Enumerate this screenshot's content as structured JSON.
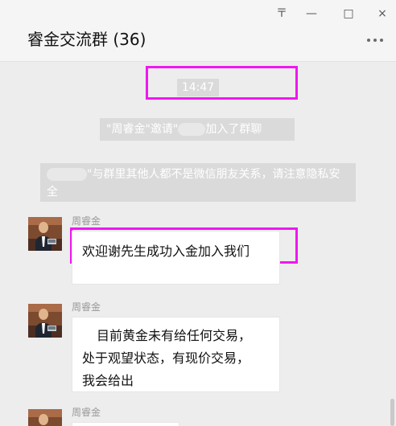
{
  "window": {
    "title": "睿金交流群 (36)",
    "pin_glyph": "〒",
    "minimize_glyph": "—",
    "maximize_glyph": "□",
    "close_glyph": "×"
  },
  "chat": {
    "timestamp": "14:47",
    "system_messages": {
      "invite_prefix": "\"周睿金\"邀请\"",
      "invite_suffix": "加入了群聊",
      "warning_suffix": "\"与群里其他人都不是微信朋友关系，请注意隐私安全"
    },
    "messages": [
      {
        "sender": "周睿金",
        "lines": [
          "欢迎谢先生成功入金加入我们"
        ]
      },
      {
        "sender": "周睿金",
        "lines": [
          "目前黄金未有给任何交易，",
          "处于观望状态，有现价交易，",
          "我会给出"
        ]
      },
      {
        "sender": "周睿金"
      }
    ]
  },
  "colors": {
    "highlight": "#ef18ef",
    "background": "#ededed",
    "bubble": "#ffffff"
  },
  "icons": {
    "more": "more-icon",
    "pin": "pin-icon",
    "minimize": "minimize-icon",
    "maximize": "maximize-icon",
    "close": "close-icon"
  }
}
